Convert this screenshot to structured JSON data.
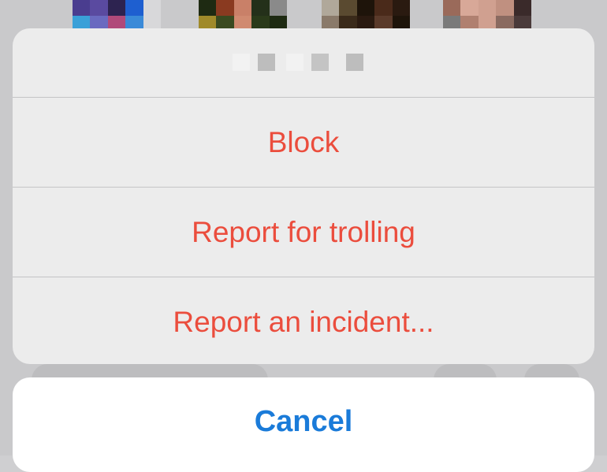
{
  "action_sheet": {
    "title": "",
    "actions": [
      {
        "label": "Block"
      },
      {
        "label": "Report for trolling"
      },
      {
        "label": "Report an incident..."
      }
    ]
  },
  "cancel": {
    "label": "Cancel"
  },
  "colors": {
    "destructive": "#eb4d3d",
    "cancel_blue": "#1a7bd9",
    "sheet_bg": "#ececec",
    "separator": "#c4c4c6"
  },
  "icons": {
    "pixelated_avatars": [
      "pixelated-avatar-icon"
    ]
  }
}
